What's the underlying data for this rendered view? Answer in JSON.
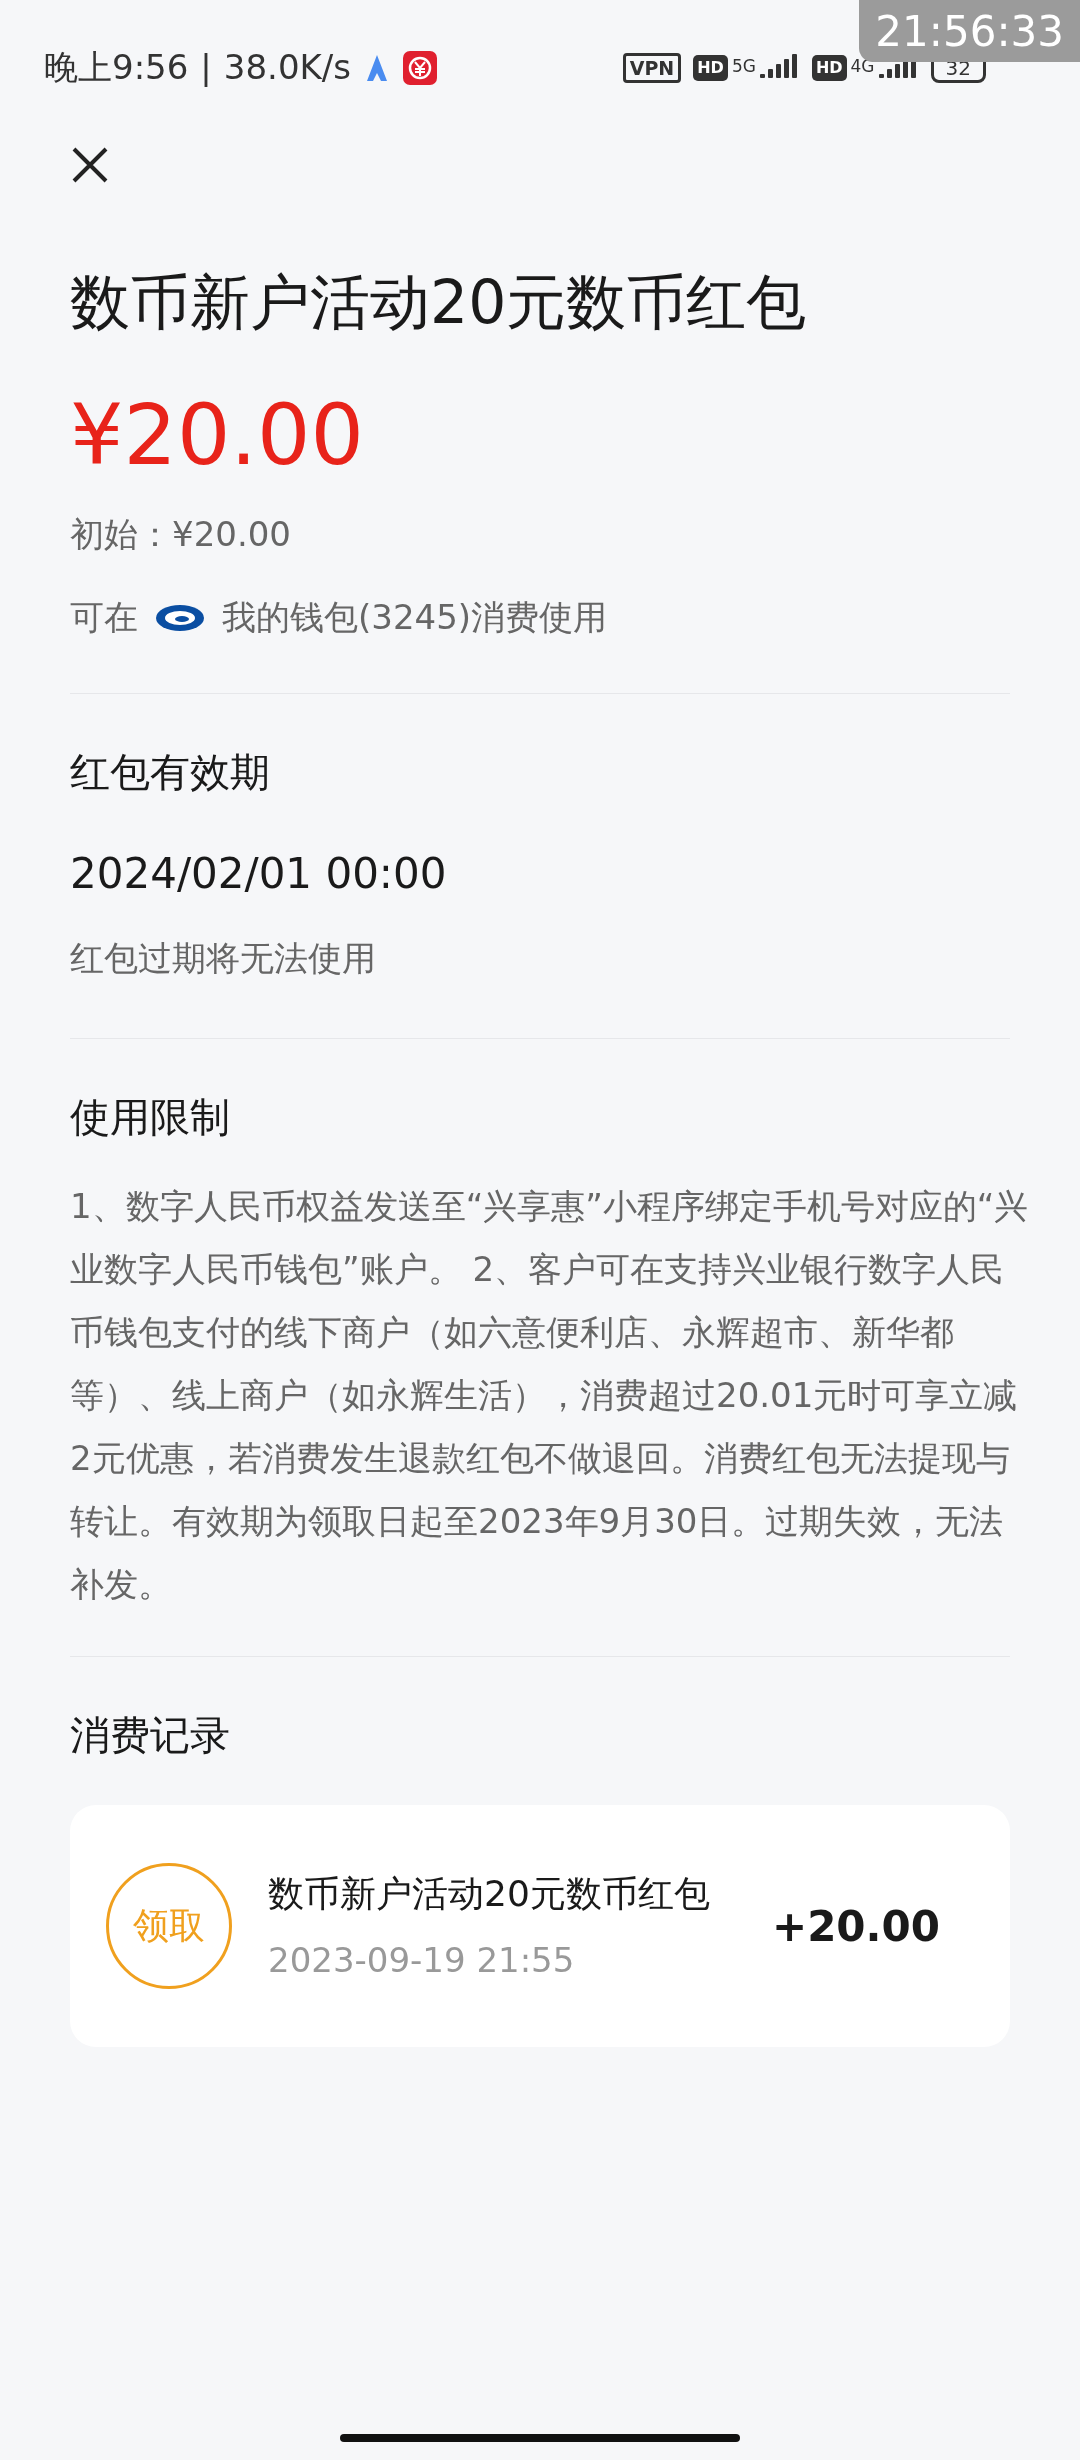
{
  "status_bar": {
    "time": "晚上9:56",
    "separator": "|",
    "speed": "38.0K/s",
    "vpn": "VPN",
    "hd": [
      "HD",
      "HD"
    ],
    "networks": [
      "5G",
      "4G"
    ],
    "battery": "32"
  },
  "recorder_clock": "21:56:33",
  "title": "数币新户活动20元数币红包",
  "amount": "¥20.00",
  "initial": "初始：¥20.00",
  "usable": {
    "prefix": "可在",
    "wallet": "我的钱包(3245)消费使用"
  },
  "sections": [
    {
      "kind": "validity",
      "heading": "红包有效期",
      "value": "2024/02/01 00:00",
      "note": "红包过期将无法使用"
    },
    {
      "kind": "rules",
      "heading": "使用限制",
      "text": "1、数字人民币权益发送至“兴享惠”小程序绑定手机号对应的“兴业数字人民币钱包”账户。 2、客户可在支持兴业银行数字人民币钱包支付的线下商户（如六意便利店、永辉超市、新华都等）、线上商户（如永辉生活），消费超过20.01元时可享立减2元优惠，若消费发生退款红包不做退回。消费红包无法提现与转让。有效期为领取日起至2023年9月30日。过期失效，无法补发。"
    },
    {
      "kind": "records",
      "heading": "消费记录",
      "records": [
        {
          "badge": "领取",
          "color": "#f0a01e",
          "name": "数币新户活动20元数币红包",
          "time": "2023-09-19 21:55",
          "amount": "+20.00"
        }
      ]
    }
  ]
}
